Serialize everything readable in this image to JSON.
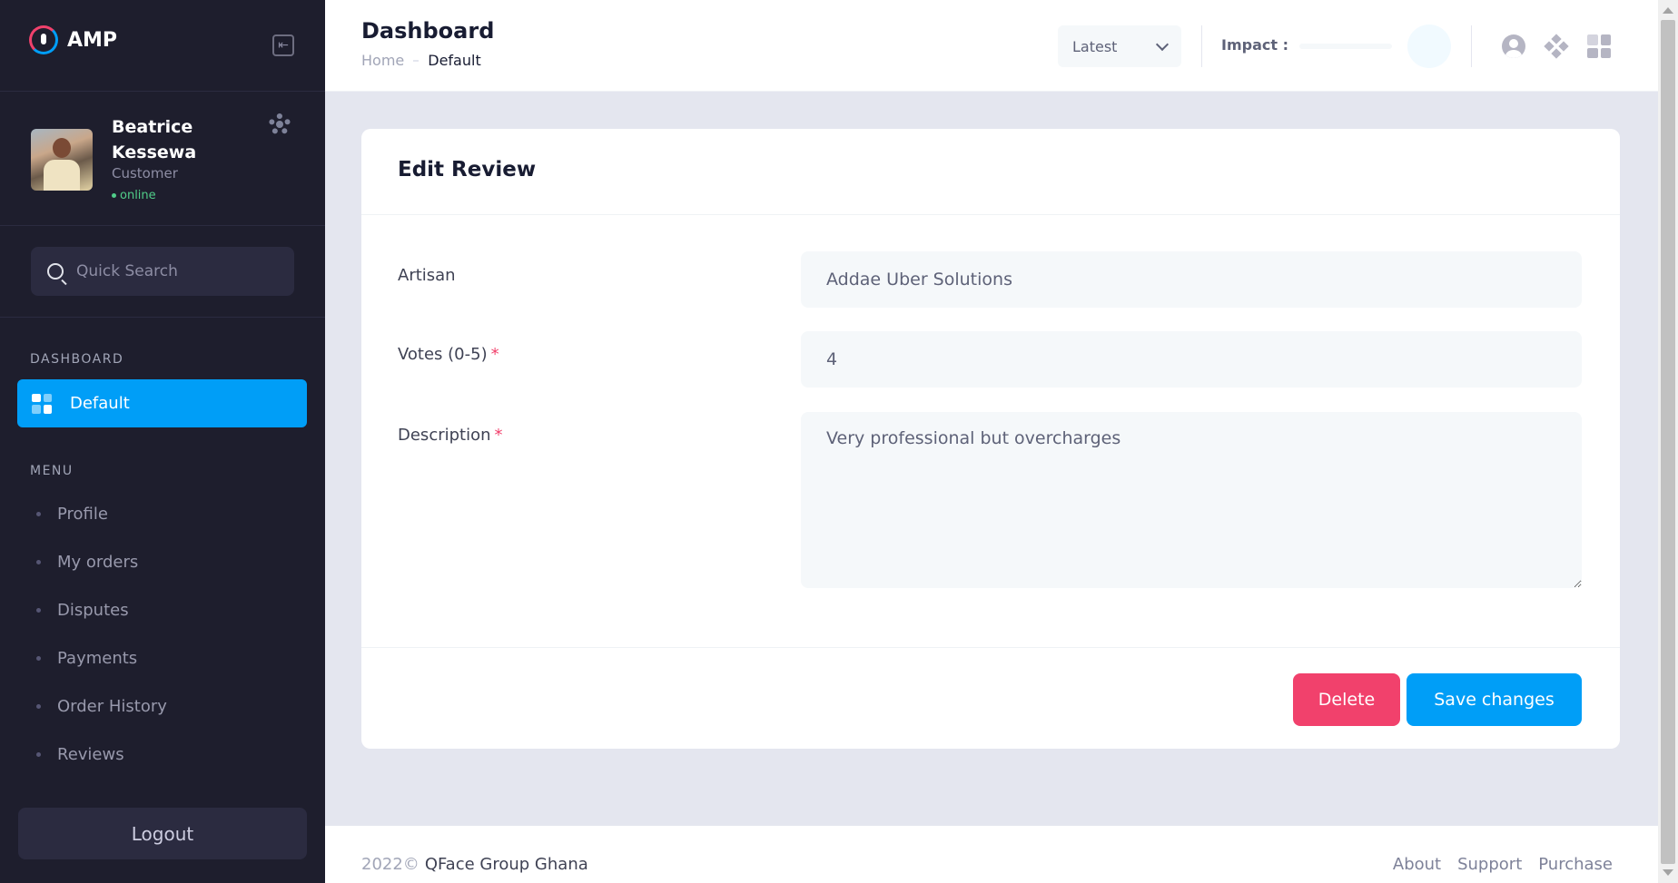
{
  "brand": {
    "name": "AMP"
  },
  "user": {
    "name": "Beatrice Kessewa",
    "role": "Customer",
    "status": "online"
  },
  "sidebar": {
    "search_placeholder": "Quick Search",
    "dashboard_section": "DASHBOARD",
    "active_item": "Default",
    "menu_section": "MENU",
    "menu_items": [
      "Profile",
      "My orders",
      "Disputes",
      "Payments",
      "Order History",
      "Reviews"
    ],
    "logout_label": "Logout"
  },
  "header": {
    "title": "Dashboard",
    "breadcrumb": [
      "Home",
      "Default"
    ],
    "select_value": "Latest",
    "impact_label": "Impact :"
  },
  "form": {
    "title": "Edit Review",
    "fields": {
      "artisan": {
        "label": "Artisan",
        "value": "Addae Uber Solutions"
      },
      "votes": {
        "label": "Votes (0-5)",
        "required_mark": "*",
        "value": "4"
      },
      "description": {
        "label": "Description",
        "required_mark": "*",
        "value": "Very professional but overcharges"
      }
    },
    "delete_label": "Delete",
    "save_label": "Save changes"
  },
  "footer": {
    "year": "2022©",
    "org": "QFace Group Ghana",
    "links": [
      "About",
      "Support",
      "Purchase"
    ]
  },
  "colors": {
    "sidebar_bg": "#1e1e2d",
    "primary": "#009ef7",
    "danger": "#f1416c",
    "success": "#50cd89"
  },
  "icons": [
    "brand-logo-icon",
    "collapse-icon",
    "gear-icon",
    "search-icon",
    "grid-icon",
    "chevron-down-icon",
    "user-icon",
    "apps-icon",
    "layout-icon"
  ]
}
